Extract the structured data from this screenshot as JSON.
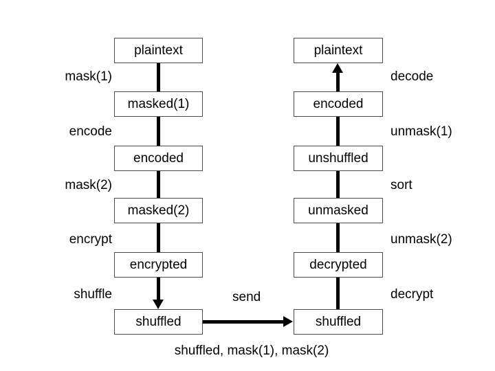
{
  "diagram": {
    "left_column": {
      "nodes": [
        {
          "label": "plaintext"
        },
        {
          "label": "masked(1)"
        },
        {
          "label": "encoded"
        },
        {
          "label": "masked(2)"
        },
        {
          "label": "encrypted"
        },
        {
          "label": "shuffled"
        }
      ],
      "edge_labels": [
        {
          "label": "mask(1)"
        },
        {
          "label": "encode"
        },
        {
          "label": "mask(2)"
        },
        {
          "label": "encrypt"
        },
        {
          "label": "shuffle"
        }
      ]
    },
    "right_column": {
      "nodes": [
        {
          "label": "plaintext"
        },
        {
          "label": "encoded"
        },
        {
          "label": "unshuffled"
        },
        {
          "label": "unmasked"
        },
        {
          "label": "decrypted"
        },
        {
          "label": "shuffled"
        }
      ],
      "edge_labels": [
        {
          "label": "decode"
        },
        {
          "label": "unmask(1)"
        },
        {
          "label": "sort"
        },
        {
          "label": "unmask(2)"
        },
        {
          "label": "decrypt"
        }
      ]
    },
    "transfer": {
      "label": "send",
      "payload_caption": "shuffled, mask(1), mask(2)"
    },
    "colors": {
      "box_border": "#4a4a4a",
      "line": "#000000",
      "text": "#000000",
      "background": "#ffffff"
    }
  }
}
